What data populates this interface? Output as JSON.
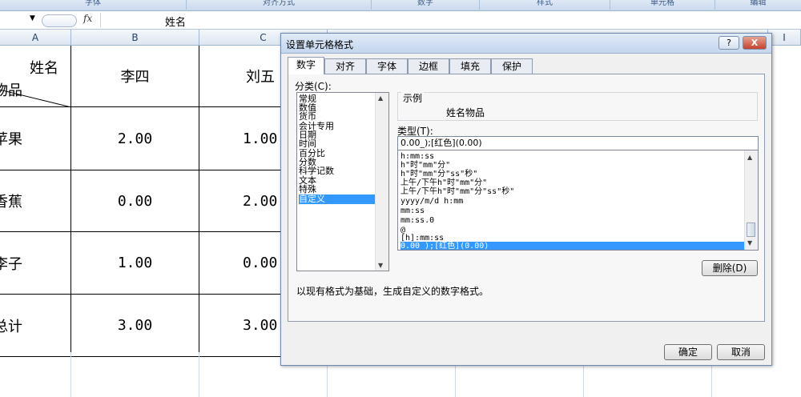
{
  "ribbon": {
    "groups": [
      "字体",
      "对齐方式",
      "数字",
      "样式",
      "单元格",
      "编辑"
    ]
  },
  "formula_bar": {
    "fx": "fx",
    "value": "姓名"
  },
  "columns": [
    "A",
    "B",
    "C",
    "I"
  ],
  "sheet": {
    "header_top": "姓名",
    "header_bottom": "物品",
    "names": [
      "李四",
      "刘五"
    ],
    "rows": [
      {
        "item": "苹果",
        "values": [
          "2.00",
          "1.00"
        ]
      },
      {
        "item": "香蕉",
        "values": [
          "0.00",
          "2.00"
        ]
      },
      {
        "item": "李子",
        "values": [
          "1.00",
          "0.00"
        ]
      },
      {
        "item": "总计",
        "values": [
          "3.00",
          "3.00"
        ]
      }
    ]
  },
  "dialog": {
    "title": "设置单元格格式",
    "help": "?",
    "close": "X",
    "tabs": [
      "数字",
      "对齐",
      "字体",
      "边框",
      "填充",
      "保护"
    ],
    "active_tab": "数字",
    "category_label": "分类(C):",
    "categories": [
      "常规",
      "数值",
      "货币",
      "会计专用",
      "日期",
      "时间",
      "百分比",
      "分数",
      "科学记数",
      "文本",
      "特殊",
      "自定义"
    ],
    "selected_category": "自定义",
    "sample_label": "示例",
    "sample_value": "姓名物品",
    "type_label": "类型(T):",
    "type_value": "0.00_);[红色](0.00)",
    "formats": [
      "h:mm:ss",
      "h\"时\"mm\"分\"",
      "h\"时\"mm\"分\"ss\"秒\"",
      "上午/下午h\"时\"mm\"分\"",
      "上午/下午h\"时\"mm\"分\"ss\"秒\"",
      "yyyy/m/d h:mm",
      "mm:ss",
      "mm:ss.0",
      "@",
      "[h]:mm:ss",
      "0.00_);[红色](0.00)"
    ],
    "selected_format": "0.00_);[红色](0.00)",
    "delete_button": "删除(D)",
    "description": "以现有格式为基础，生成自定义的数字格式。",
    "ok_button": "确定",
    "cancel_button": "取消"
  }
}
